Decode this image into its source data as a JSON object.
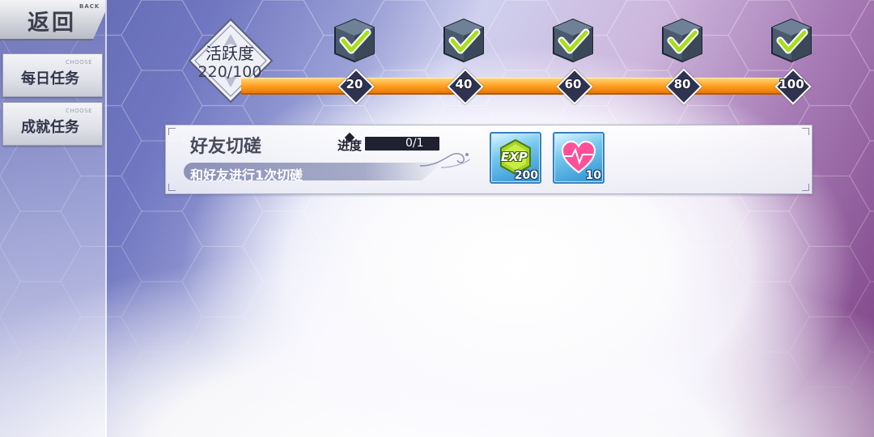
{
  "sidebar": {
    "back": {
      "label": "返回",
      "sub": "BACK"
    },
    "items": [
      {
        "label": "每日任务",
        "tag": "CHOOSE"
      },
      {
        "label": "成就任务",
        "tag": "CHOOSE"
      }
    ]
  },
  "activity": {
    "title": "活跃度",
    "value": "220/100",
    "milestones": [
      {
        "label": "20",
        "claimed": true
      },
      {
        "label": "40",
        "claimed": true
      },
      {
        "label": "60",
        "claimed": true
      },
      {
        "label": "80",
        "claimed": true
      },
      {
        "label": "100",
        "claimed": true
      }
    ],
    "fill_fraction": 1.0
  },
  "task": {
    "name": "好友切磋",
    "description": "和好友进行1次切磋",
    "progress_label": "进度",
    "progress_value": "0/1",
    "rewards": [
      {
        "icon": "exp-icon",
        "text": "EXP",
        "quantity": "200"
      },
      {
        "icon": "heart-icon",
        "quantity": "10"
      }
    ]
  },
  "colors": {
    "bar_orange": "#ff9d1c",
    "check_green": "#a6e01a",
    "reward_blue": "#2b8fd0"
  }
}
